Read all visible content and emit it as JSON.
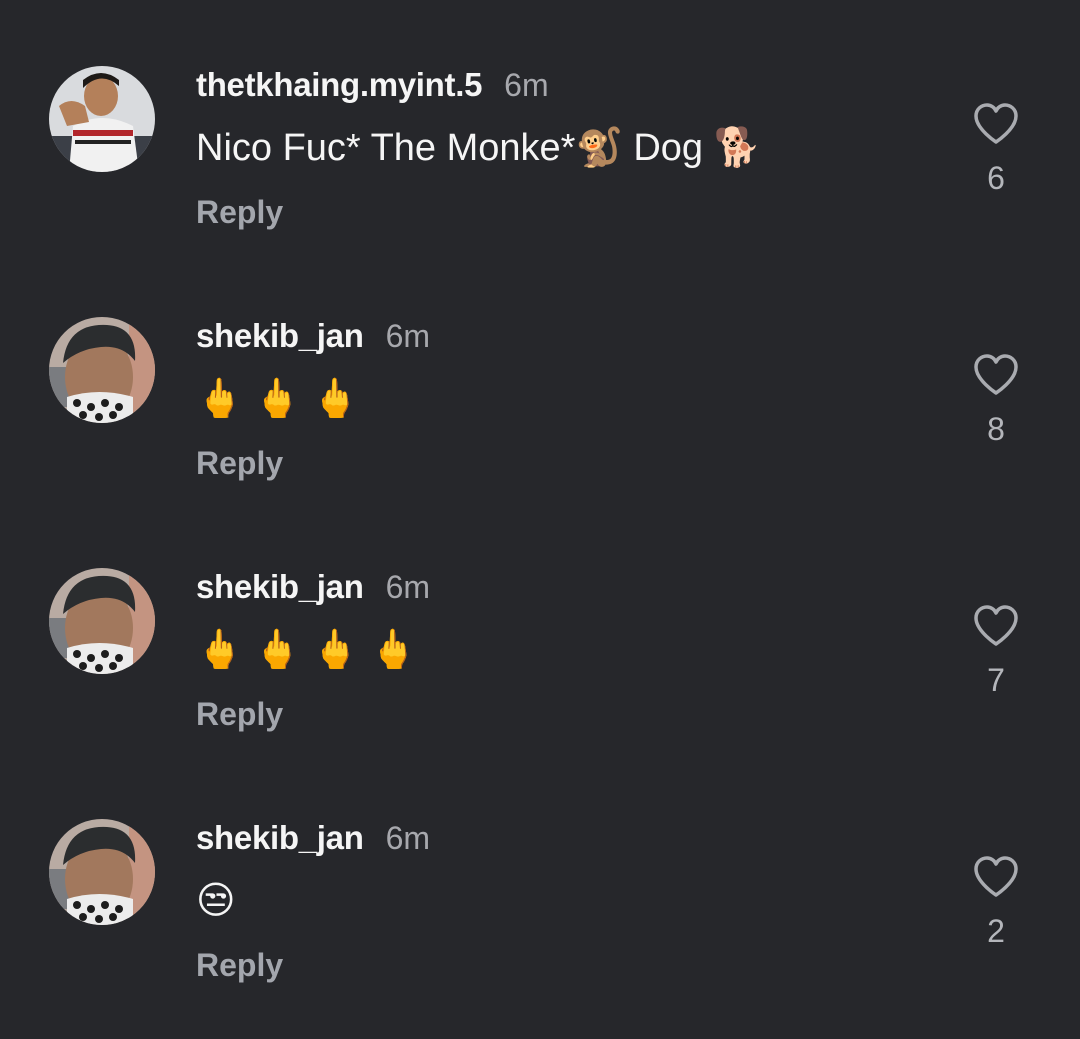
{
  "comments": [
    {
      "username": "thetkhaing.myint.5",
      "time": "6m",
      "text": "Nico Fuc* The Monke*🐒 Dog 🐕",
      "reply_label": "Reply",
      "likes": "6",
      "avatar": "user-photo-shirt"
    },
    {
      "username": "shekib_jan",
      "time": "6m",
      "text": "🖕 🖕 🖕",
      "reply_label": "Reply",
      "likes": "8",
      "avatar": "user-photo-mask"
    },
    {
      "username": "shekib_jan",
      "time": "6m",
      "text": "🖕 🖕 🖕 🖕",
      "reply_label": "Reply",
      "likes": "7",
      "avatar": "user-photo-mask"
    },
    {
      "username": "shekib_jan",
      "time": "6m",
      "text": "😒",
      "reply_label": "Reply",
      "likes": "2",
      "avatar": "user-photo-mask"
    }
  ],
  "icons": {
    "like": "heart-outline-icon"
  },
  "colors": {
    "background": "#26272b",
    "username": "#f5f5f5",
    "muted": "#a7a8ad"
  }
}
